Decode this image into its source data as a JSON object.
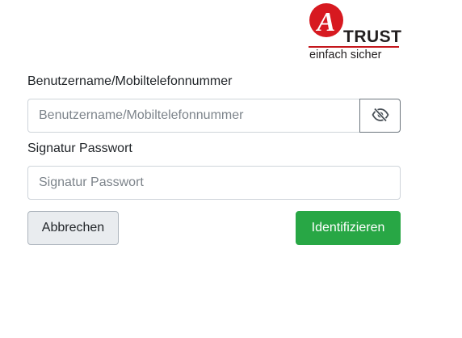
{
  "logo": {
    "brand_letter": "A",
    "brand_name": "TRUST",
    "slogan": "einfach sicher",
    "colors": {
      "red": "#d71920",
      "dark": "#231f20"
    }
  },
  "form": {
    "username": {
      "label": "Benutzername/Mobiltelefonnummer",
      "placeholder": "Benutzername/Mobiltelefonnummer",
      "value": "",
      "toggle_icon": "eye-slash-icon"
    },
    "password": {
      "label": "Signatur Passwort",
      "placeholder": "Signatur Passwort",
      "value": ""
    },
    "buttons": {
      "cancel_label": "Abbrechen",
      "identify_label": "Identifizieren"
    }
  },
  "colors": {
    "primary_green": "#28a745",
    "secondary_gray": "#e9ecef",
    "border": "#ced4da"
  }
}
